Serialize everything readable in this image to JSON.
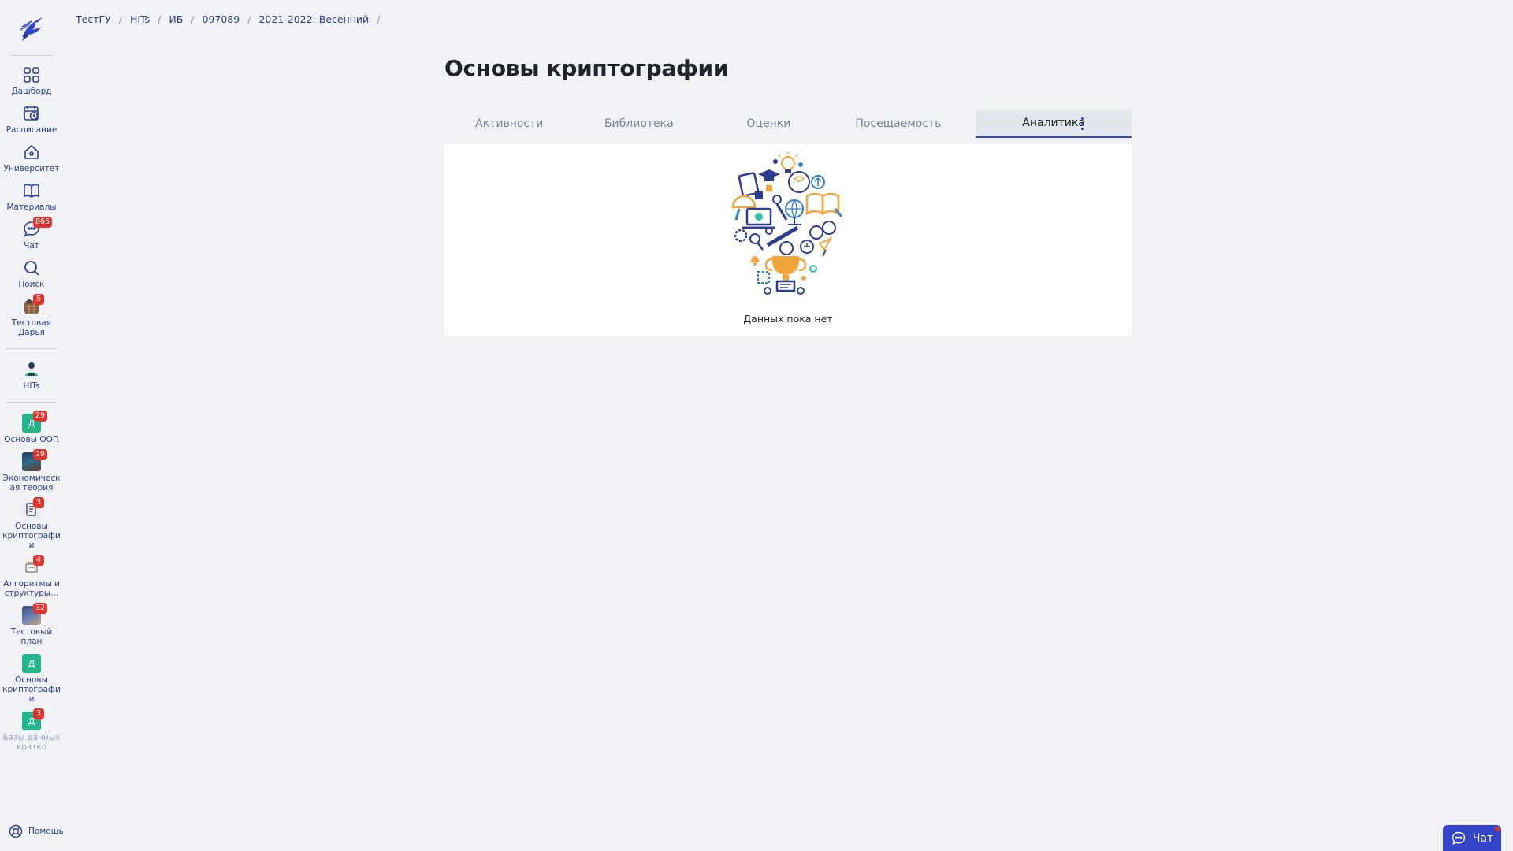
{
  "breadcrumb": {
    "items": [
      "ТестГУ",
      "HITs",
      "ИБ",
      "097089",
      "2021-2022: Весенний"
    ],
    "separator": "/"
  },
  "sidebar": {
    "main": [
      {
        "label": "Дашборд",
        "icon": "grid-icon"
      },
      {
        "label": "Расписание",
        "icon": "calendar-clock-icon"
      },
      {
        "label": "Университет",
        "icon": "home-icon"
      },
      {
        "label": "Материалы",
        "icon": "book-icon"
      },
      {
        "label": "Чат",
        "icon": "chat-bubble-icon",
        "badge": "865"
      },
      {
        "label": "Поиск",
        "icon": "search-icon"
      },
      {
        "label": "Тестовая Дарья",
        "icon": "user-avatar-icon",
        "badge": "5"
      }
    ],
    "org": {
      "label": "HITs",
      "icon": "hits-logo-icon"
    },
    "courses": [
      {
        "label": "Основы ООП",
        "icon_text": "Д",
        "badge": "29"
      },
      {
        "label": "Экономическая теория",
        "badge": "29"
      },
      {
        "label": "Основы криптографии",
        "badge": "3"
      },
      {
        "label": "Алгоритмы и структуры...",
        "badge": "4"
      },
      {
        "label": "Тестовый план",
        "badge": "32"
      },
      {
        "label": "Основы криптографии",
        "icon_text": "Д"
      },
      {
        "label": "Базы данных кратко",
        "icon_text": "Д",
        "badge": "3"
      }
    ],
    "help_label": "Помощь"
  },
  "main": {
    "title": "Основы криптографии",
    "tabs": [
      "Активности",
      "Библиотека",
      "Оценки",
      "Посещаемость",
      "Аналитика"
    ],
    "active_tab": "Аналитика",
    "empty_text": "Данных пока нет"
  },
  "chat_button": {
    "label": "Чат"
  },
  "colors": {
    "accent": "#3346c9",
    "nav_text": "#2c3e8f",
    "badge": "#e0342c",
    "background": "#f0f2f6"
  }
}
